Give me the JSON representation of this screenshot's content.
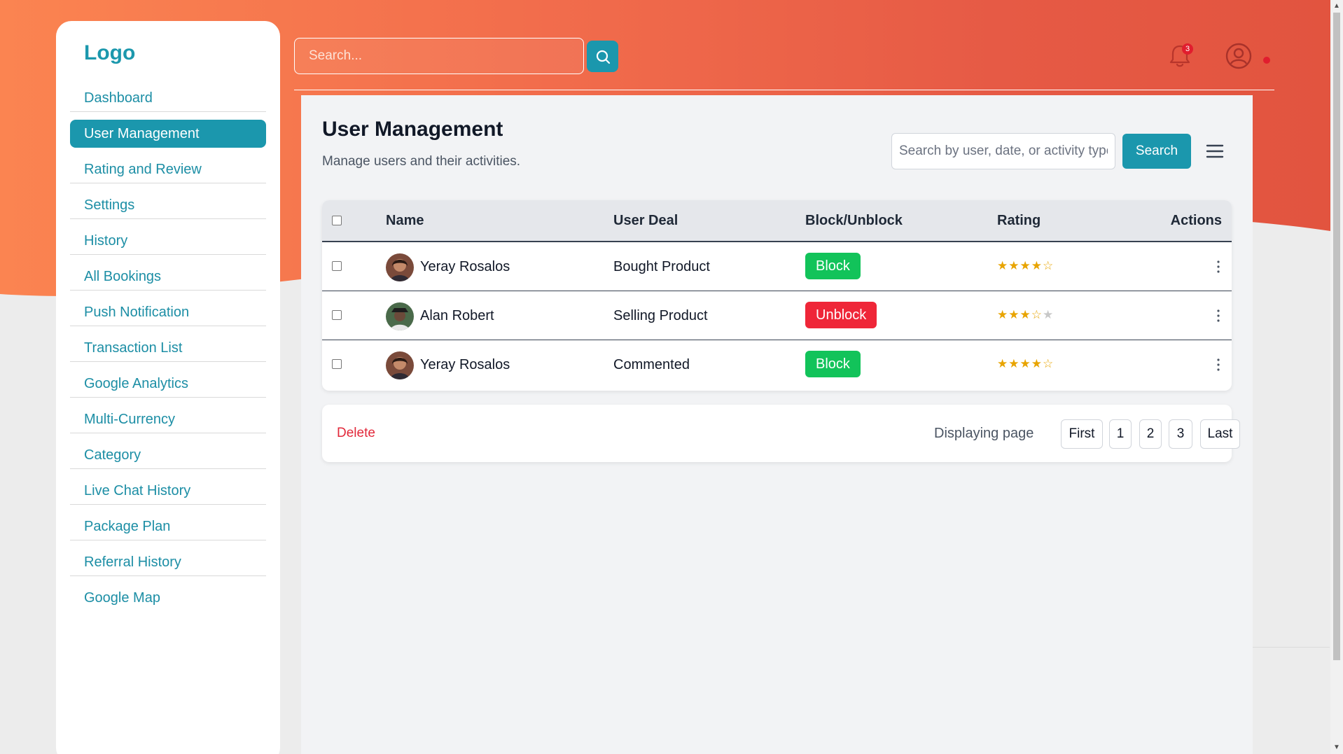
{
  "sidebar": {
    "logo": "Logo",
    "items": [
      {
        "label": "Dashboard"
      },
      {
        "label": "User Management"
      },
      {
        "label": "Rating and Review"
      },
      {
        "label": "Settings"
      },
      {
        "label": "History"
      },
      {
        "label": "All Bookings"
      },
      {
        "label": "Push Notification"
      },
      {
        "label": "Transaction List"
      },
      {
        "label": "Google Analytics"
      },
      {
        "label": "Multi-Currency"
      },
      {
        "label": "Category"
      },
      {
        "label": "Live Chat History"
      },
      {
        "label": "Package Plan"
      },
      {
        "label": "Referral History"
      },
      {
        "label": "Google Map"
      }
    ],
    "active_index": 1
  },
  "topbar": {
    "search_placeholder": "Search...",
    "notification_count": "3"
  },
  "main": {
    "title": "User Management",
    "subtitle": "Manage users and their activities.",
    "filter_placeholder": "Search by user, date, or activity type",
    "search_button": "Search",
    "table": {
      "headers": {
        "name": "Name",
        "deal": "User Deal",
        "block": "Block/Unblock",
        "rating": "Rating",
        "actions": "Actions"
      },
      "rows": [
        {
          "name": "Yeray Rosalos",
          "deal": "Bought Product",
          "status": "Block",
          "rating": 4
        },
        {
          "name": "Alan Robert",
          "deal": "Selling Product",
          "status": "Unblock",
          "rating": 3
        },
        {
          "name": "Yeray Rosalos",
          "deal": "Commented",
          "status": "Block",
          "rating": 4
        }
      ]
    },
    "pager": {
      "delete_label": "Delete",
      "label": "Displaying page",
      "first": "First",
      "pages": [
        "1",
        "2",
        "3"
      ],
      "last": "Last"
    }
  },
  "colors": {
    "accent": "#1b97ad",
    "block": "#12c35a",
    "unblock": "#ef2638",
    "star": "#e8a400",
    "header_gradient_start": "#fb8451",
    "header_gradient_end": "#e2543f"
  }
}
